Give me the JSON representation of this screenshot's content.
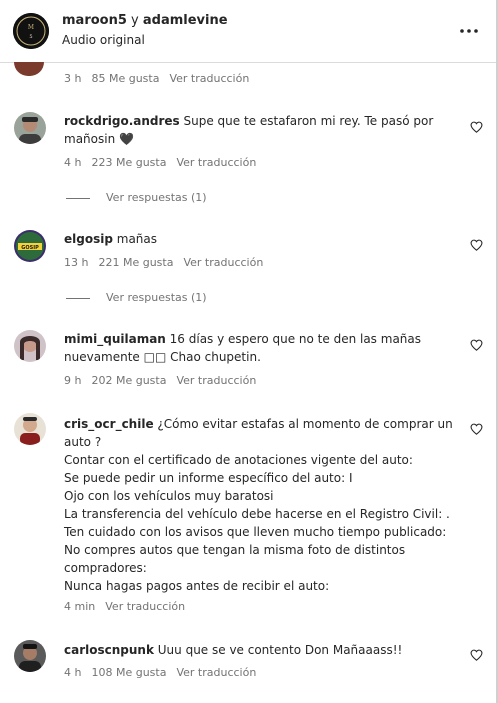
{
  "header": {
    "account_primary": "maroon5",
    "joiner": " y ",
    "account_secondary": "adamlevine",
    "subtitle": "Audio original",
    "more_icon": "more-horizontal-icon"
  },
  "colors": {
    "text": "#262626",
    "muted": "#737373",
    "divider": "#dbdbdb"
  },
  "top_meta": {
    "time": "3 h",
    "likes": "85 Me gusta",
    "translate": "Ver traducción"
  },
  "comments": [
    {
      "username": "rockdrigo.andres",
      "text": " Supe que te estafaron mi rey. Te pasó por\nmañosin 🖤",
      "time": "4 h",
      "likes": "223 Me gusta",
      "translate": "Ver traducción",
      "replies": "Ver respuestas (1)"
    },
    {
      "username": "elgosip",
      "text": " mañas",
      "time": "13 h",
      "likes": "221 Me gusta",
      "translate": "Ver traducción",
      "replies": "Ver respuestas (1)"
    },
    {
      "username": "mimi_quilaman",
      "text": " 16 días y espero que no te den las mañas\nnuevamente □□ Chao chupetin.",
      "time": "9 h",
      "likes": "202 Me gusta",
      "translate": "Ver traducción"
    },
    {
      "username": "cris_ocr_chile",
      "text": " ¿Cómo evitar estafas al momento de comprar un\nauto ?\nContar con el certificado de anotaciones vigente del auto:\nSe puede pedir un informe específico del auto: I\nOjo con los vehículos muy baratosi\nLa transferencia del vehículo debe hacerse en el Registro Civil: .\nTen cuidado con los avisos que lleven mucho tiempo publicado:\nNo compres autos que tengan la misma foto de distintos\ncompradores:\nNunca hagas pagos antes de recibir el auto:",
      "time": "4 min",
      "translate": "Ver traducción"
    },
    {
      "username": "carloscnpunk",
      "text": " Uuu que se ve contento Don Mañaaass!!",
      "time": "4 h",
      "likes": "108 Me gusta",
      "translate": "Ver traducción"
    }
  ]
}
